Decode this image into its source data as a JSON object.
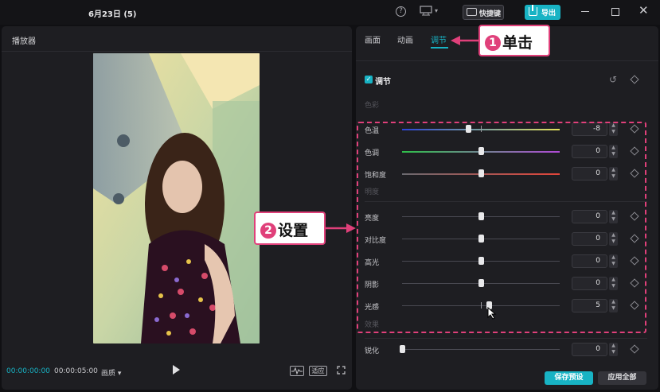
{
  "window": {
    "title": "6月23日 (5)"
  },
  "toolbar": {
    "shortcut_label": "快捷键",
    "export_label": "导出"
  },
  "player": {
    "title": "播放器",
    "time_current": "00:00:00:00",
    "time_total": "00:00:05:00",
    "quality_label": "画质",
    "fit_label": "适应"
  },
  "inspector": {
    "tabs": [
      "画面",
      "动画",
      "调节"
    ],
    "active_tab": "调节",
    "section_title": "调节",
    "groups": {
      "color": "色彩",
      "lightness": "明度",
      "effects": "效果"
    },
    "sliders": [
      {
        "label": "色温",
        "value": "-8",
        "level": -8,
        "track": "temperature"
      },
      {
        "label": "色调",
        "value": "0",
        "level": 0,
        "track": "tint"
      },
      {
        "label": "饱和度",
        "value": "0",
        "level": 0,
        "track": "saturation"
      },
      {
        "label": "亮度",
        "value": "0",
        "level": 0,
        "track": "plain"
      },
      {
        "label": "对比度",
        "value": "0",
        "level": 0,
        "track": "plain"
      },
      {
        "label": "高光",
        "value": "0",
        "level": 0,
        "track": "plain"
      },
      {
        "label": "阴影",
        "value": "0",
        "level": 0,
        "track": "plain"
      },
      {
        "label": "光感",
        "value": "5",
        "level": 5,
        "track": "plain"
      },
      {
        "label": "锐化",
        "value": "0",
        "level": 0,
        "track": "plain"
      }
    ],
    "save_preset_label": "保存预设",
    "apply_all_label": "应用全部"
  },
  "annotations": {
    "step1": {
      "num": "1",
      "text": "单击"
    },
    "step2": {
      "num": "2",
      "text": "设置"
    }
  },
  "colors": {
    "accent": "#18b3c4",
    "annotation": "#e0407a"
  },
  "icons": [
    "help-icon",
    "layout-icon",
    "keyboard-icon",
    "export-icon",
    "minimize-icon",
    "maximize-icon",
    "close-icon",
    "play-icon",
    "waveform-icon",
    "fullscreen-icon",
    "reset-icon",
    "keyframe-icon",
    "checkbox-icon"
  ]
}
